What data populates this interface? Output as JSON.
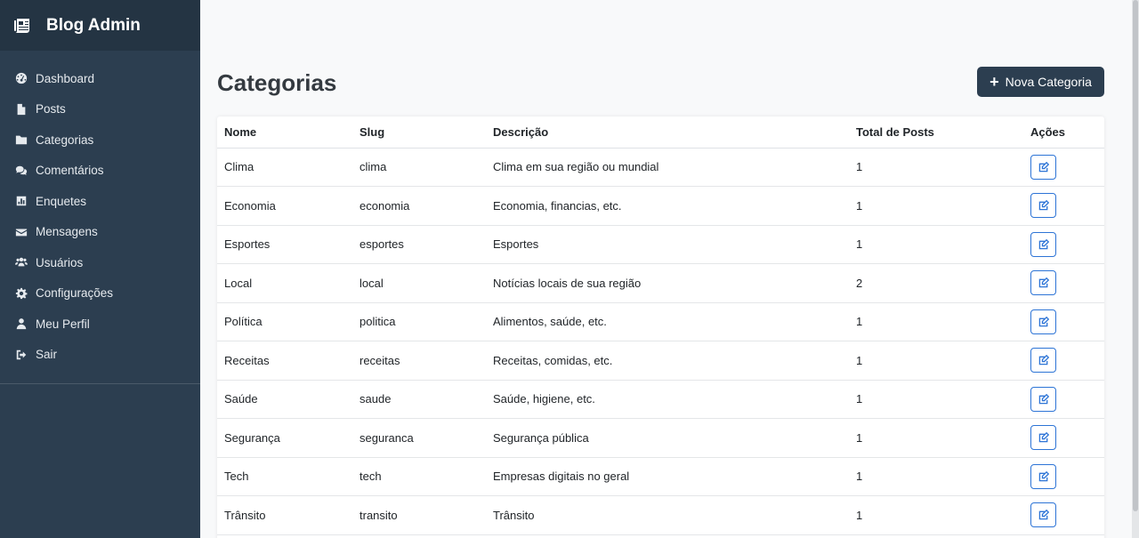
{
  "sidebar": {
    "brand": "Blog Admin",
    "items": [
      {
        "label": "Dashboard",
        "icon": "dashboard-icon"
      },
      {
        "label": "Posts",
        "icon": "file-icon"
      },
      {
        "label": "Categorias",
        "icon": "folder-icon"
      },
      {
        "label": "Comentários",
        "icon": "comments-icon"
      },
      {
        "label": "Enquetes",
        "icon": "chart-icon"
      },
      {
        "label": "Mensagens",
        "icon": "envelope-icon"
      },
      {
        "label": "Usuários",
        "icon": "users-icon"
      },
      {
        "label": "Configurações",
        "icon": "gear-icon"
      },
      {
        "label": "Meu Perfil",
        "icon": "user-icon"
      },
      {
        "label": "Sair",
        "icon": "sign-out-icon"
      }
    ]
  },
  "main": {
    "title": "Categorias",
    "new_button": "Nova Categoria",
    "columns": [
      "Nome",
      "Slug",
      "Descrição",
      "Total de Posts",
      "Ações"
    ],
    "rows": [
      {
        "nome": "Clima",
        "slug": "clima",
        "descricao": "Clima em sua região ou mundial",
        "total": "1"
      },
      {
        "nome": "Economia",
        "slug": "economia",
        "descricao": "Economia, financias, etc.",
        "total": "1"
      },
      {
        "nome": "Esportes",
        "slug": "esportes",
        "descricao": "Esportes",
        "total": "1"
      },
      {
        "nome": "Local",
        "slug": "local",
        "descricao": "Notícias locais de sua região",
        "total": "2"
      },
      {
        "nome": "Política",
        "slug": "politica",
        "descricao": "Alimentos, saúde, etc.",
        "total": "1"
      },
      {
        "nome": "Receitas",
        "slug": "receitas",
        "descricao": "Receitas, comidas, etc.",
        "total": "1"
      },
      {
        "nome": "Saúde",
        "slug": "saude",
        "descricao": "Saúde, higiene, etc.",
        "total": "1"
      },
      {
        "nome": "Segurança",
        "slug": "seguranca",
        "descricao": "Segurança pública",
        "total": "1"
      },
      {
        "nome": "Tech",
        "slug": "tech",
        "descricao": "Empresas digitais no geral",
        "total": "1"
      },
      {
        "nome": "Trânsito",
        "slug": "transito",
        "descricao": "Trânsito",
        "total": "1"
      }
    ]
  },
  "colors": {
    "sidebar": "#2c3e50",
    "brand_bar": "#243443",
    "accent": "#2d74d6"
  }
}
